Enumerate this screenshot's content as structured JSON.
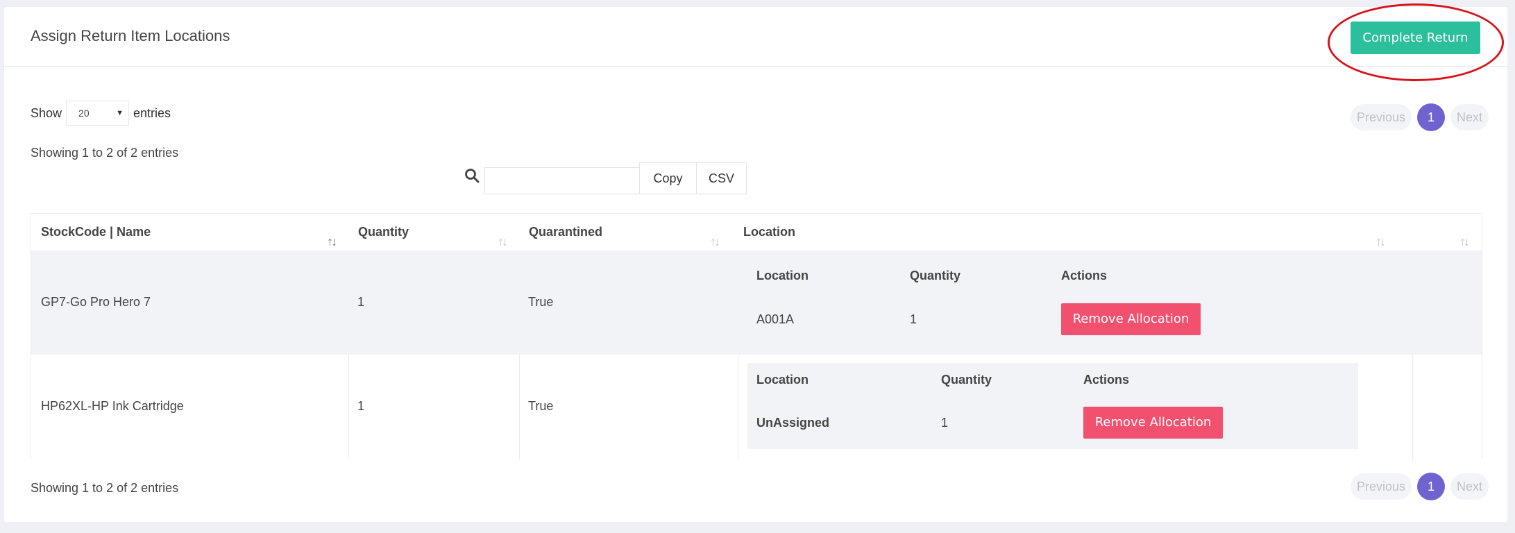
{
  "header": {
    "title": "Assign Return Item Locations",
    "complete_button": "Complete Return"
  },
  "length_menu": {
    "prefix": "Show",
    "value": "20",
    "suffix": "entries"
  },
  "info": {
    "top": "Showing 1 to 2 of 2 entries",
    "bottom": "Showing 1 to 2 of 2 entries"
  },
  "pagination": {
    "previous": "Previous",
    "current": "1",
    "next": "Next"
  },
  "toolbar": {
    "copy": "Copy",
    "csv": "CSV",
    "search_value": ""
  },
  "table": {
    "columns": [
      "StockCode | Name",
      "Quantity",
      "Quarantined",
      "Location"
    ],
    "rows": [
      {
        "stock": "GP7-Go Pro Hero 7",
        "quantity": "1",
        "quarantined": "True",
        "allocation": {
          "headers": [
            "Location",
            "Quantity",
            "Actions"
          ],
          "location": "A001A",
          "quantity": "1",
          "action": "Remove Allocation"
        }
      },
      {
        "stock": "HP62XL-HP Ink Cartridge",
        "quantity": "1",
        "quarantined": "True",
        "allocation": {
          "headers": [
            "Location",
            "Quantity",
            "Actions"
          ],
          "location": "UnAssigned",
          "quantity": "1",
          "action": "Remove Allocation"
        }
      }
    ]
  },
  "colors": {
    "primary": "#2bbf9c",
    "danger": "#f1506e",
    "page_active": "#6f63d0",
    "annotation": "#d7141c"
  },
  "icons": {
    "search": "search-icon",
    "sort": "sort-icon"
  }
}
